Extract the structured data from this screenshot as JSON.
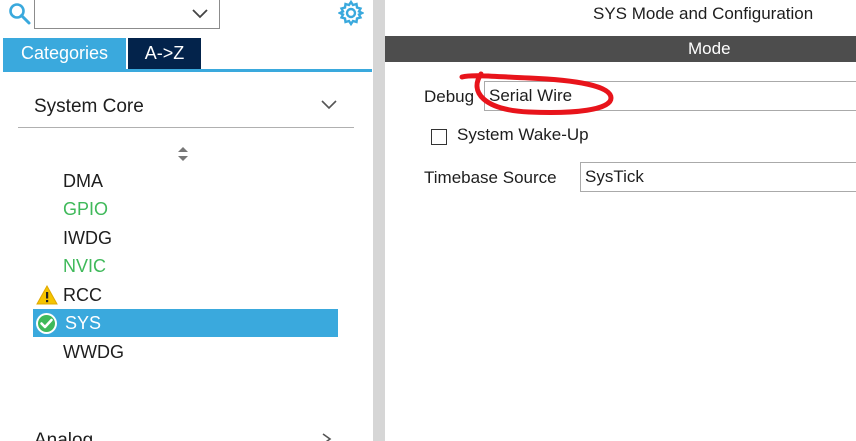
{
  "sidebar": {
    "search": {
      "value": "",
      "placeholder": ""
    },
    "tabs": [
      {
        "label": "Categories",
        "active": true
      },
      {
        "label": "A->Z",
        "active": false
      }
    ],
    "category": {
      "label": "System Core"
    },
    "items": [
      {
        "label": "DMA",
        "status": "none",
        "color": "#1e1e1e"
      },
      {
        "label": "GPIO",
        "status": "none",
        "color": "#3fb95a"
      },
      {
        "label": "IWDG",
        "status": "none",
        "color": "#1e1e1e"
      },
      {
        "label": "NVIC",
        "status": "none",
        "color": "#3fb95a"
      },
      {
        "label": "RCC",
        "status": "warning-icon",
        "color": "#1e1e1e"
      },
      {
        "label": "SYS",
        "status": "check-icon",
        "selected": true,
        "color": "#ffffff"
      },
      {
        "label": "WWDG",
        "status": "none",
        "color": "#1e1e1e"
      }
    ],
    "next_category": {
      "label": "Analog"
    }
  },
  "config": {
    "title": "SYS Mode and Configuration",
    "mode_header": "Mode",
    "debug": {
      "label": "Debug",
      "value": "Serial Wire"
    },
    "wakeup": {
      "label": "System Wake-Up",
      "checked": false
    },
    "timebase": {
      "label": "Timebase Source",
      "value": "SysTick"
    }
  },
  "colors": {
    "accent": "#3aa9dd",
    "tab_dark": "#03234b",
    "mode_bar": "#4d4d4d",
    "enabled_green": "#3fb95a",
    "warning": "#f5c400",
    "annotation_red": "#e8141b"
  }
}
